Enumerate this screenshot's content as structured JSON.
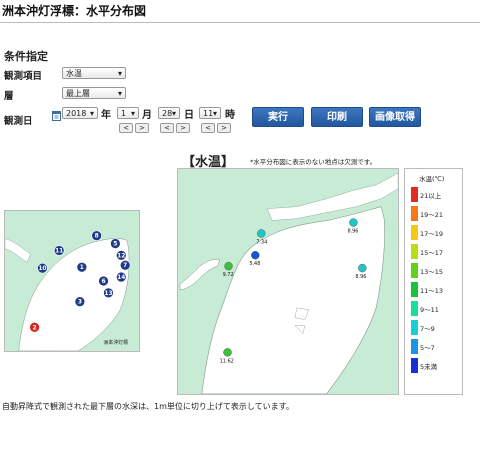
{
  "header": {
    "title": "洲本沖灯浮標：水平分布図"
  },
  "conditions": {
    "heading": "条件指定",
    "item_label": "観測項目",
    "item_value": "水温",
    "layer_label": "層",
    "layer_value": "最上層",
    "date_label": "観測日",
    "year": "2018",
    "year_unit": "年",
    "month": "1",
    "month_unit": "月",
    "day": "28",
    "day_unit": "日",
    "hour": "11",
    "hour_unit": "時",
    "prev": "<",
    "next": ">"
  },
  "actions": {
    "run": "実行",
    "print": "印刷",
    "save_image": "画像取得"
  },
  "map": {
    "heading": "【水温】",
    "note": "*水平分布図に表示のない地点は欠測です。",
    "stations": [
      {
        "value": "7.34",
        "color": "#1fc8c8"
      },
      {
        "value": "8.96",
        "color": "#1fc8c8"
      },
      {
        "value": "9.72",
        "color": "#3bc43b"
      },
      {
        "value": "5.48",
        "color": "#1557d1"
      },
      {
        "value": "8.96",
        "color": "#1fc8c8"
      },
      {
        "value": "11.62",
        "color": "#3bc43b"
      }
    ]
  },
  "legend": {
    "title": "水温(℃)",
    "items": [
      {
        "label": "21以上",
        "color": "#e32b1f"
      },
      {
        "label": "19～21",
        "color": "#f47a19"
      },
      {
        "label": "17～19",
        "color": "#f5c814"
      },
      {
        "label": "15～17",
        "color": "#b6df1a"
      },
      {
        "label": "13～15",
        "color": "#5fd21e"
      },
      {
        "label": "11～13",
        "color": "#1bc23a"
      },
      {
        "label": "9～11",
        "color": "#1ddc9f"
      },
      {
        "label": "7～9",
        "color": "#18cfd5"
      },
      {
        "label": "5～7",
        "color": "#1a96e5"
      },
      {
        "label": "5未満",
        "color": "#1a2fd6"
      }
    ]
  },
  "inset": {
    "caption": "洲本沖灯標",
    "markers": [
      {
        "label": "8",
        "type": "blue"
      },
      {
        "label": "5",
        "type": "blue"
      },
      {
        "label": "11",
        "type": "blue"
      },
      {
        "label": "12",
        "type": "blue"
      },
      {
        "label": "7",
        "type": "blue"
      },
      {
        "label": "10",
        "type": "blue"
      },
      {
        "label": "1",
        "type": "blue"
      },
      {
        "label": "14",
        "type": "blue"
      },
      {
        "label": "6",
        "type": "blue"
      },
      {
        "label": "13",
        "type": "blue"
      },
      {
        "label": "3",
        "type": "blue"
      },
      {
        "label": "2",
        "type": "red"
      }
    ]
  },
  "footnote": "自動昇降式で観測された最下層の水深は、1m単位に切り上げて表示しています。"
}
